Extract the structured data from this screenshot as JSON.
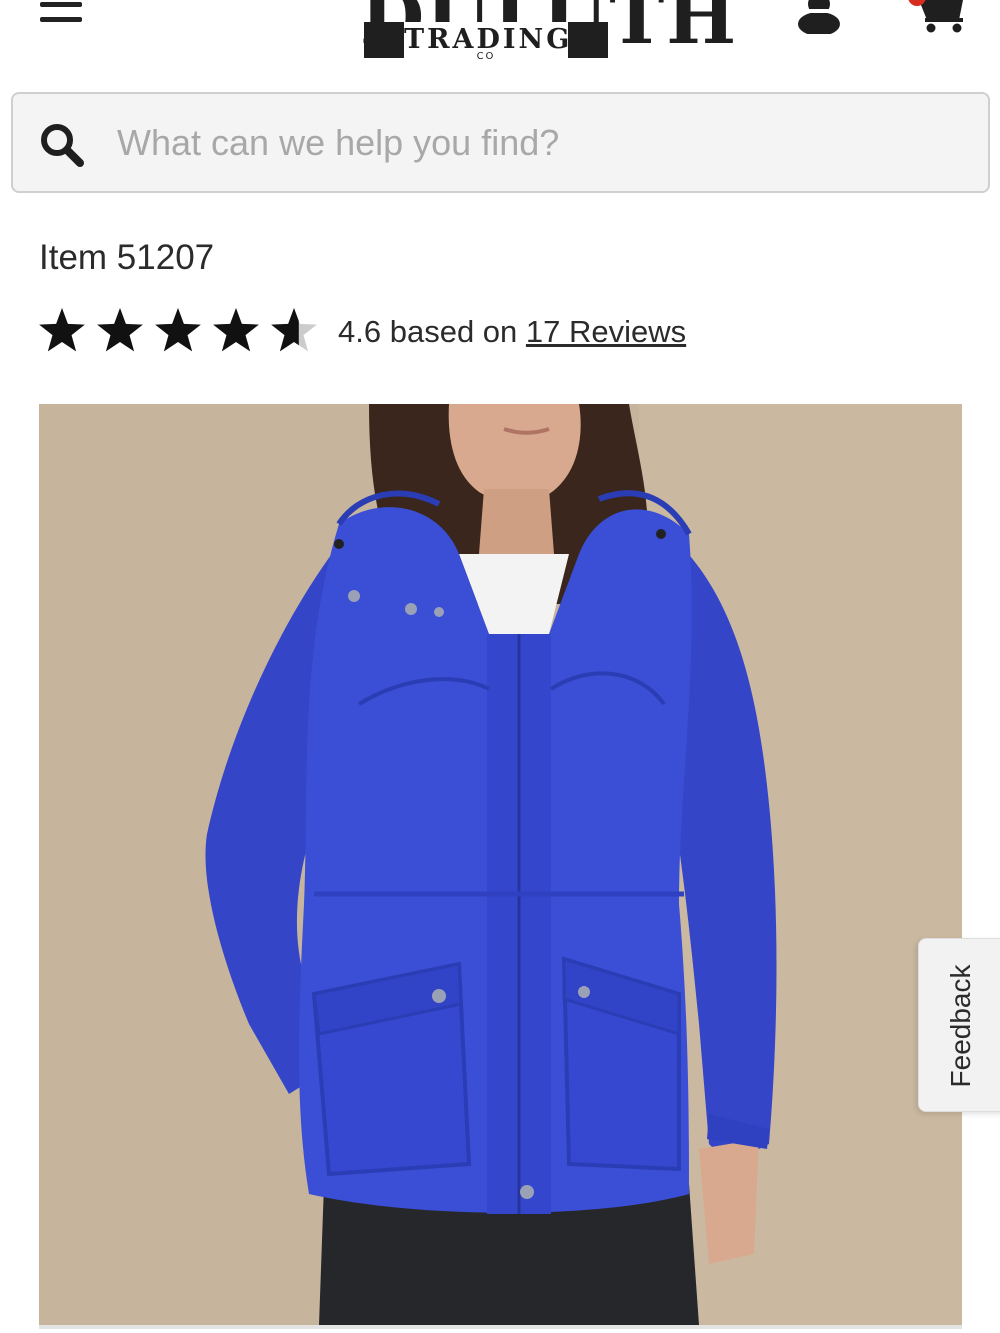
{
  "header": {
    "menu_icon": "hamburger-menu-icon",
    "logo": {
      "name": "DULUTH",
      "sub": "TRADING",
      "co": "CO"
    },
    "account_icon": "user-account-icon",
    "cart_icon": "shopping-cart-icon"
  },
  "search": {
    "icon": "search-icon",
    "placeholder": "What can we help you find?",
    "value": ""
  },
  "product": {
    "item_label": "Item 51207",
    "rating": {
      "value": "4.6",
      "stars_filled": 4.6,
      "stars_total": 5,
      "suffix": "based on",
      "reviews_link": "17 Reviews"
    },
    "image_alt": "Woman wearing blue hooded rain jacket"
  },
  "feedback_tab": {
    "label": "Feedback"
  },
  "colors": {
    "text": "#2b2b2b",
    "placeholder": "#a8a8a8",
    "star": "#111111",
    "star_empty": "#cccccc",
    "cart_badge": "#d62d20",
    "jacket_blue": "#3b4fd6",
    "background_wall": "#c9b89f"
  }
}
